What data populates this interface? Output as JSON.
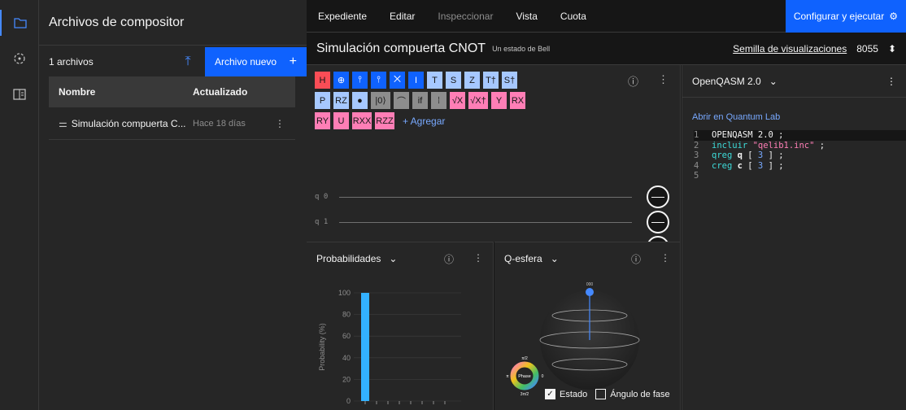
{
  "left_panel": {
    "title": "Archivos de compositor",
    "count": "1 archivos",
    "new_file": "Archivo nuevo",
    "col_name": "Nombre",
    "col_updated": "Actualizado",
    "files": [
      {
        "name": "Simulación compuerta C...",
        "updated": "Hace 18 días"
      }
    ]
  },
  "menu": {
    "items": [
      {
        "label": "Expediente",
        "disabled": false
      },
      {
        "label": "Editar",
        "disabled": false
      },
      {
        "label": "Inspeccionar",
        "disabled": true
      },
      {
        "label": "Vista",
        "disabled": false
      },
      {
        "label": "Cuota",
        "disabled": false
      }
    ],
    "run": "Configurar y ejecutar"
  },
  "circuit": {
    "title": "Simulación compuerta CNOT",
    "subtitle": "Un estado de Bell",
    "seed_label": "Semilla de visualizaciones",
    "seed_value": "8055",
    "qubits": [
      "q 0",
      "q 1"
    ]
  },
  "gates": {
    "row1": [
      {
        "label": "H",
        "color": "red"
      },
      {
        "label": "⊕",
        "color": "blue2"
      },
      {
        "label": "⫯",
        "color": "blue2"
      },
      {
        "label": "⫯",
        "color": "blue2"
      },
      {
        "label": "⨉",
        "color": "blue2"
      },
      {
        "label": "I",
        "color": "blue2"
      },
      {
        "label": "T",
        "color": "lb"
      },
      {
        "label": "S",
        "color": "lb"
      },
      {
        "label": "Z",
        "color": "lb"
      },
      {
        "label": "T†",
        "color": "lb"
      },
      {
        "label": "S†",
        "color": "lb"
      }
    ],
    "row2": [
      {
        "label": "P",
        "color": "lb"
      },
      {
        "label": "RZ",
        "color": "lb"
      },
      {
        "label": "●",
        "color": "lb"
      },
      {
        "label": "|0⟩",
        "color": "gray"
      },
      {
        "label": "⌒",
        "color": "gray"
      },
      {
        "label": "if",
        "color": "gray"
      },
      {
        "label": "⁞",
        "color": "gray"
      },
      {
        "label": "√X",
        "color": "pink"
      },
      {
        "label": "√X†",
        "color": "pink"
      },
      {
        "label": "Y",
        "color": "pink"
      },
      {
        "label": "RX",
        "color": "pink"
      }
    ],
    "row3": [
      {
        "label": "RY",
        "color": "pink"
      },
      {
        "label": "U",
        "color": "pink"
      },
      {
        "label": "RXX",
        "color": "pink"
      },
      {
        "label": "RZZ",
        "color": "pink"
      }
    ],
    "add": "+ Agregar"
  },
  "probabilities": {
    "title": "Probabilidades",
    "chart_data": {
      "type": "bar",
      "ylabel": "Probability (%)",
      "yticks": [
        0,
        20,
        40,
        60,
        80,
        100
      ],
      "ylim": [
        0,
        100
      ],
      "values": [
        100,
        0,
        0,
        0,
        0,
        0,
        0,
        0
      ]
    }
  },
  "qsphere": {
    "title": "Q-esfera",
    "top_label": "000",
    "phase": {
      "center": "Phase",
      "top": "π/2",
      "left": "π",
      "right": "0",
      "bottom": "3π/2"
    },
    "state_label": "Estado",
    "phase_label": "Ángulo de fase",
    "state_checked": true,
    "phase_checked": false
  },
  "qasm": {
    "title": "OpenQASM 2.0",
    "link": "Abrir en Quantum Lab",
    "lines": [
      "OPENQASM 2.0 ;",
      "incluir \"qelib1.inc\" ;",
      "qreg q [ 3 ] ;",
      "creg c [ 3 ] ;",
      ""
    ],
    "line_numbers": [
      "1",
      "2",
      "3",
      "4",
      "5"
    ]
  },
  "colors": {
    "accent": "#0f62fe",
    "bar": "#33b1ff",
    "link": "#78a9ff"
  }
}
